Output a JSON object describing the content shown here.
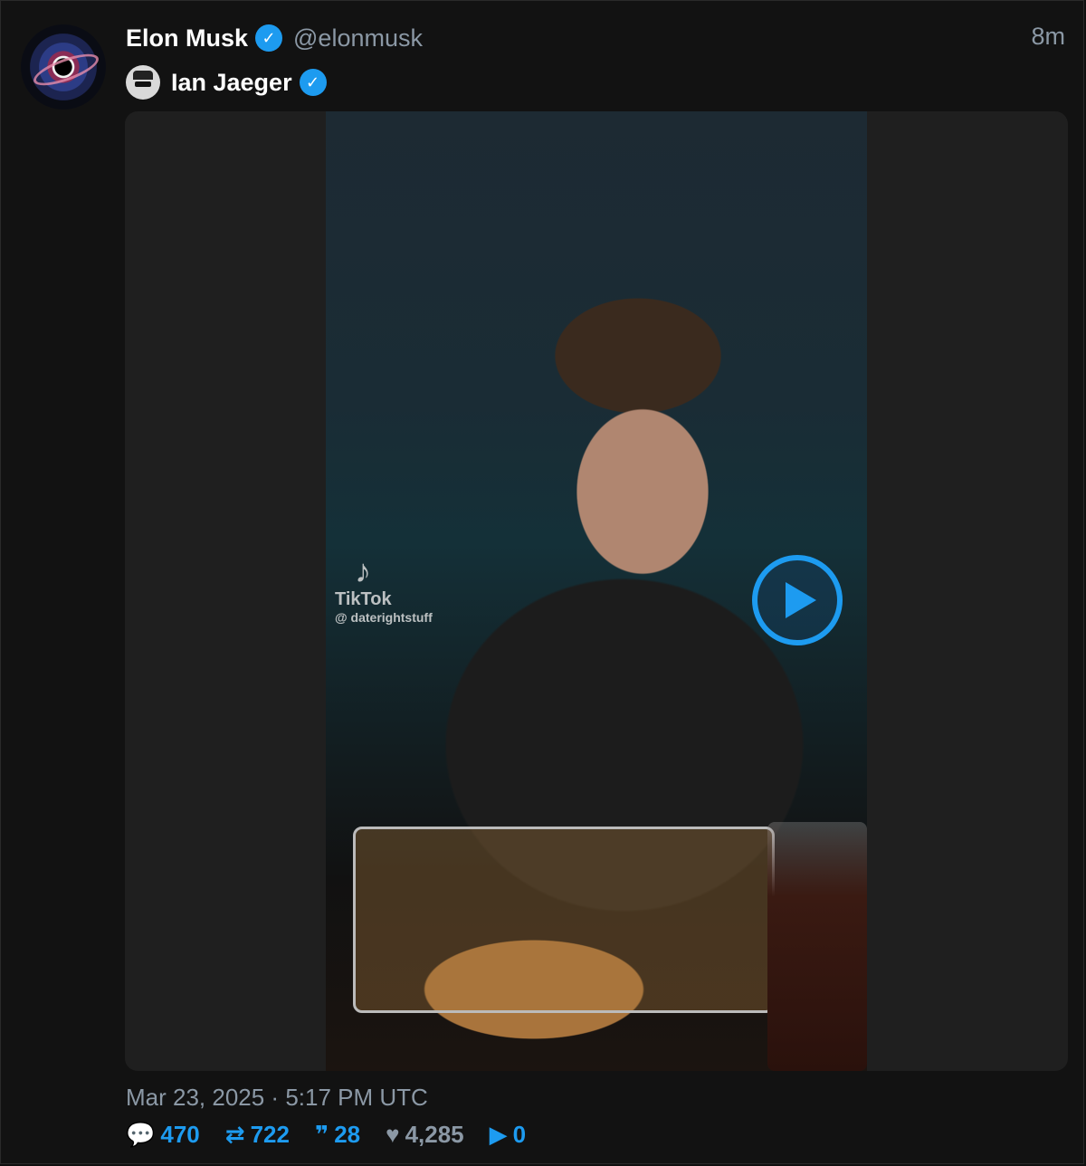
{
  "tweet": {
    "author_name": "Elon Musk",
    "author_handle": "@elonmusk",
    "relative_time": "8m",
    "reply_to_name": "Ian Jaeger",
    "media": {
      "watermark_app": "TikTok",
      "watermark_handle": "@ daterightstuff",
      "play_icon": "play-icon"
    },
    "timestamp": "Mar 23, 2025 · 5:17 PM UTC",
    "stats": {
      "replies": "470",
      "retweets": "722",
      "quotes": "28",
      "likes": "4,285",
      "views": "0"
    }
  },
  "colors": {
    "accent": "#1d9bf0",
    "muted": "#8b98a5",
    "background": "#121212"
  }
}
